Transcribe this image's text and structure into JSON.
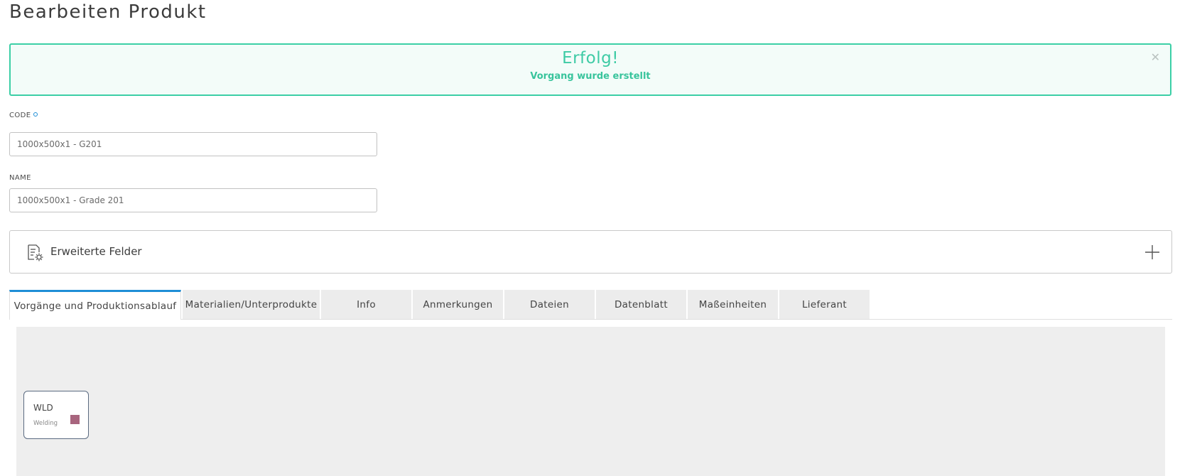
{
  "page": {
    "title": "Bearbeiten Produkt"
  },
  "alert": {
    "title": "Erfolg!",
    "message": "Vorgang wurde erstellt",
    "close_icon": "close-icon",
    "color": "#3ccfa6"
  },
  "form": {
    "code": {
      "label": "CODE",
      "required": true,
      "value": "1000x500x1 - G201"
    },
    "name": {
      "label": "NAME",
      "value": "1000x500x1 - Grade 201"
    }
  },
  "extended_fields": {
    "label": "Erweiterte Felder",
    "icon": "document-settings-icon",
    "toggle_icon": "plus-icon"
  },
  "tabs": [
    {
      "label": "Vorgänge und Produktionsablauf",
      "active": true
    },
    {
      "label": "Materialien/Unterprodukte",
      "active": false
    },
    {
      "label": "Info",
      "active": false
    },
    {
      "label": "Anmerkungen",
      "active": false
    },
    {
      "label": "Dateien",
      "active": false
    },
    {
      "label": "Datenblatt",
      "active": false
    },
    {
      "label": "Maßeinheiten",
      "active": false
    },
    {
      "label": "Lieferant",
      "active": false
    }
  ],
  "workflow": {
    "operations": [
      {
        "code": "WLD",
        "name": "Welding",
        "color": "#a8657e"
      }
    ]
  },
  "colors": {
    "accent": "#1e8ed6",
    "success": "#3ccfa6"
  }
}
